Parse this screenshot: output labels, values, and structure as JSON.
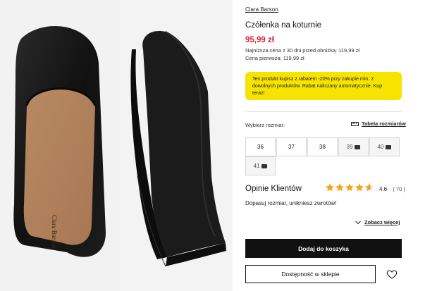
{
  "product": {
    "brand": "Clara Barson",
    "title": "Czółenka na koturnie",
    "price": "95,99 zł",
    "lowest_price": "Najniższa cena z 30 dni przed obniżką: 119,99 zł",
    "first_price": "Cena pierwsza: 119,99 zł",
    "insole_logo": "Clara Barson"
  },
  "promo": {
    "text": "Ten produkt kupisz z rabatem -20% przy zakupie min. 2 dowolnych produktów. Rabat naliczany automatycznie. Kup teraz!",
    "color": "#f7e300"
  },
  "sizes": {
    "label": "Wybierz rozmiar:",
    "table_link": "Tabela rozmiarów",
    "options": [
      {
        "size": "36",
        "available": true
      },
      {
        "size": "37",
        "available": true
      },
      {
        "size": "38",
        "available": true
      },
      {
        "size": "39",
        "available": false
      },
      {
        "size": "40",
        "available": false
      },
      {
        "size": "41",
        "available": false
      }
    ]
  },
  "reviews": {
    "title": "Opinie Klientów",
    "rating": "4.6",
    "count": "( 70 )",
    "stars_value": 4.6,
    "fit_text": "Dopasuj rozmiar, unikniesz zwrotów!",
    "see_more": "Zobacz więcej"
  },
  "actions": {
    "add_to_cart": "Dodaj do koszyka",
    "store_availability": "Dostępność w sklepie"
  },
  "colors": {
    "price": "#d6243a",
    "star": "#f2a516",
    "primary_button": "#111111"
  }
}
